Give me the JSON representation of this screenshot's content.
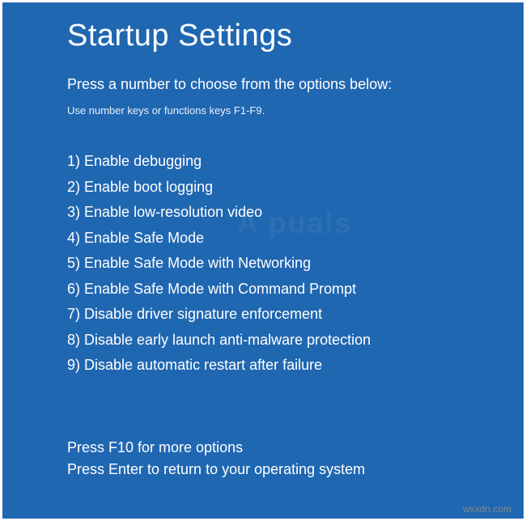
{
  "title": "Startup Settings",
  "subtitle": "Press a number to choose from the options below:",
  "hint": "Use number keys or functions keys F1-F9.",
  "options": [
    {
      "num": "1",
      "label": "Enable debugging"
    },
    {
      "num": "2",
      "label": "Enable boot logging"
    },
    {
      "num": "3",
      "label": "Enable low-resolution video"
    },
    {
      "num": "4",
      "label": "Enable Safe Mode"
    },
    {
      "num": "5",
      "label": "Enable Safe Mode with Networking"
    },
    {
      "num": "6",
      "label": "Enable Safe Mode with Command Prompt"
    },
    {
      "num": "7",
      "label": "Disable driver signature enforcement"
    },
    {
      "num": "8",
      "label": "Disable early launch anti-malware protection"
    },
    {
      "num": "9",
      "label": "Disable automatic restart after failure"
    }
  ],
  "footer": {
    "more": "Press F10 for more options",
    "enter": "Press Enter to return to your operating system"
  },
  "watermark": "wsxdn.com",
  "bg_watermark": "A  puals"
}
